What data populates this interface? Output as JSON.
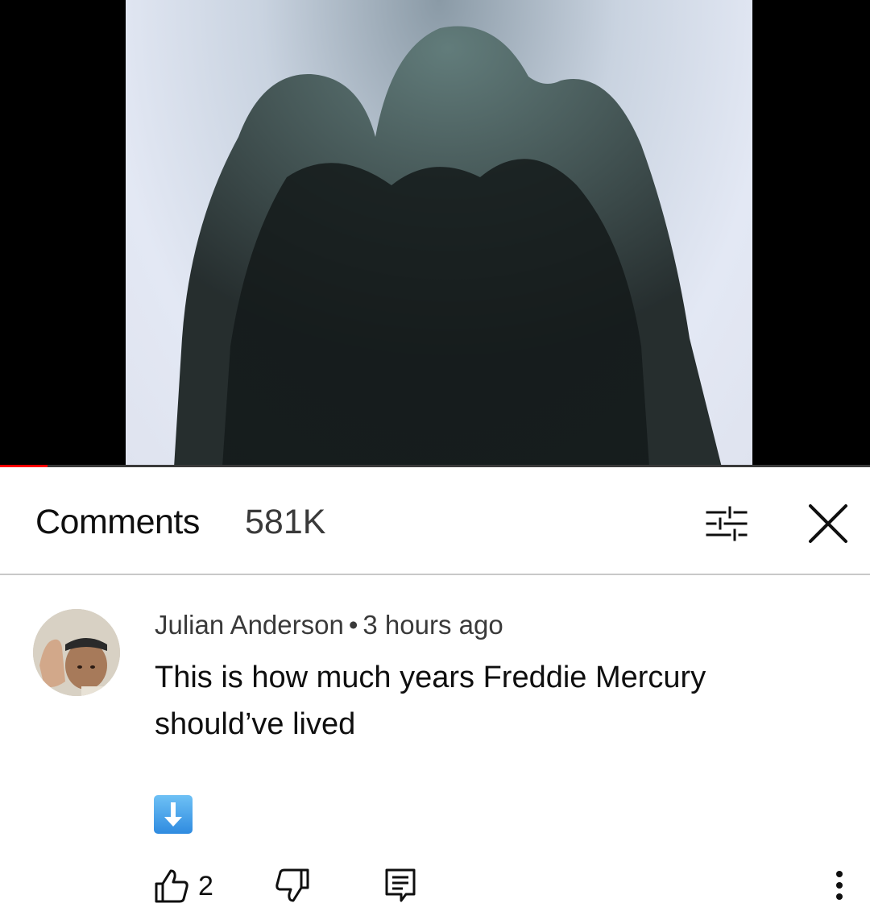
{
  "video": {
    "progress": 0.055,
    "progress_color": "#ff0000"
  },
  "comments_panel": {
    "title": "Comments",
    "count": "581K",
    "filter_icon": "sort-filter-icon",
    "close_icon": "close-icon"
  },
  "comment": {
    "author": "Julian Anderson",
    "separator": "•",
    "time": "3 hours ago",
    "text_line1": "This is how much years Freddie Mercury",
    "text_line2": "should’ve lived",
    "emoji": "down-arrow-emoji",
    "likes": "2",
    "like_icon": "thumbs-up-icon",
    "dislike_icon": "thumbs-down-icon",
    "reply_icon": "reply-icon",
    "more_icon": "more-vertical-icon"
  }
}
